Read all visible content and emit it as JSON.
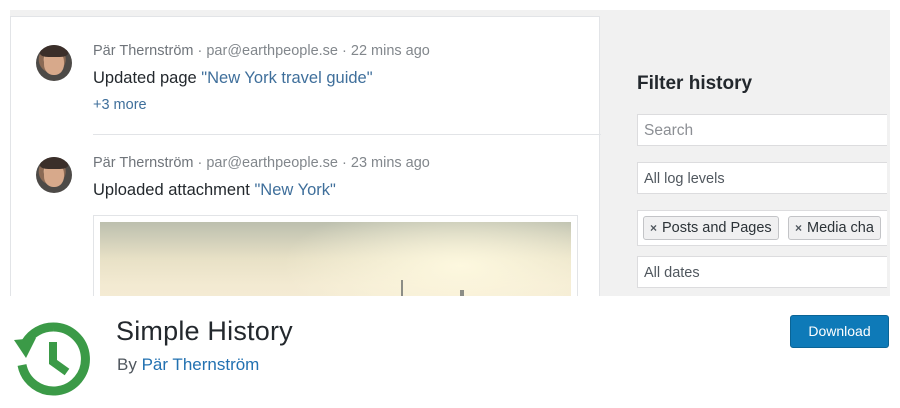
{
  "log": {
    "entries": [
      {
        "author": "Pär Thernström",
        "email": "par@earthpeople.se",
        "time": "22 mins ago",
        "message_prefix": "Updated page ",
        "message_link": "\"New York travel guide\"",
        "more": "+3 more"
      },
      {
        "author": "Pär Thernström",
        "email": "par@earthpeople.se",
        "time": "23 mins ago",
        "message_prefix": "Uploaded attachment ",
        "message_link": "\"New York\""
      }
    ],
    "separator": " · "
  },
  "filter": {
    "title": "Filter history",
    "search_placeholder": "Search",
    "log_levels": "All log levels",
    "tags": [
      "Posts and Pages",
      "Media cha"
    ],
    "tag_remove_icon": "×",
    "dates": "All dates"
  },
  "plugin": {
    "name": "Simple History",
    "by_prefix": "By ",
    "author": "Pär Thernström",
    "download_label": "Download",
    "icon": "history-clock-icon",
    "colors": {
      "icon_green": "#3b9a47",
      "button_blue": "#0e7ab8",
      "link_blue": "#2271b1"
    }
  }
}
